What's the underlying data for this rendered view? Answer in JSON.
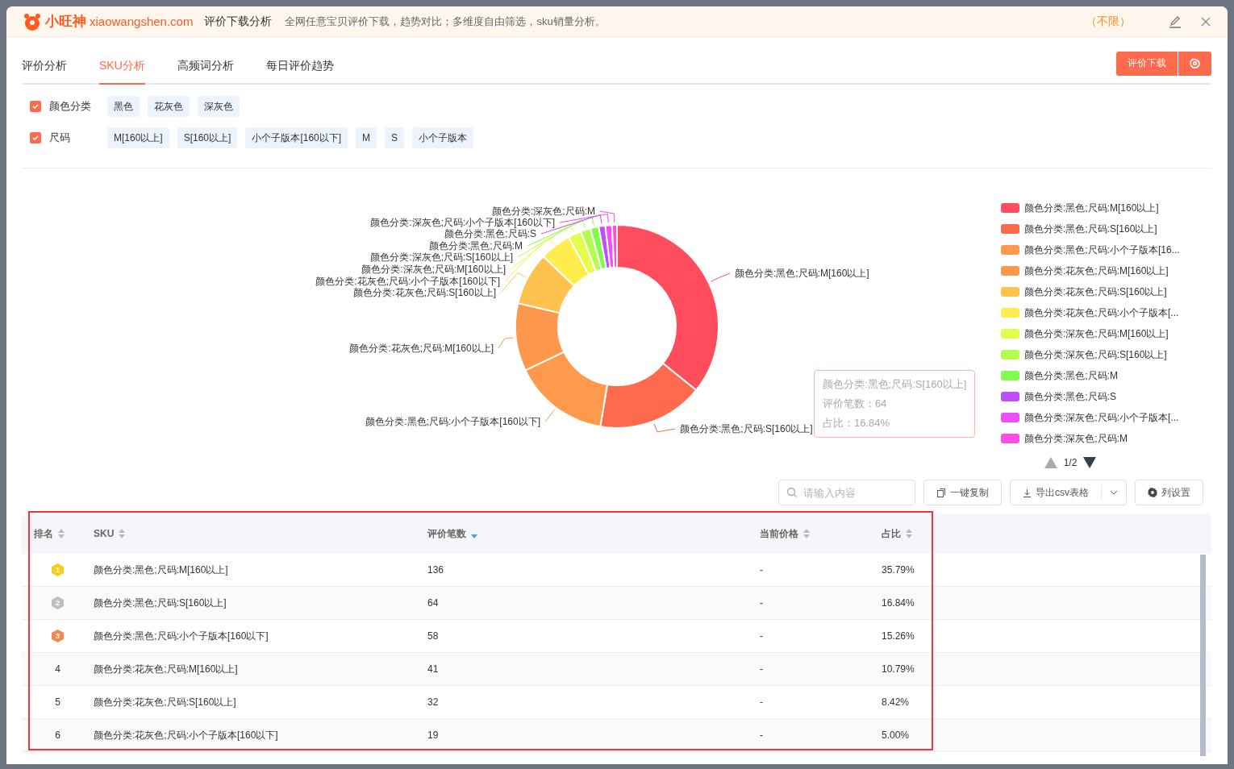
{
  "header": {
    "brand": "小旺神",
    "domain": "xiaowangshen.com",
    "title": "评价下载分析",
    "description": "全网任意宝贝评价下载，趋势对比；多维度自由筛选，sku销量分析。",
    "quota": "（不限）"
  },
  "tabs": [
    {
      "label": "评价分析",
      "selected": false
    },
    {
      "label": "SKU分析",
      "selected": true
    },
    {
      "label": "高频词分析",
      "selected": false
    },
    {
      "label": "每日评价趋势",
      "selected": false
    }
  ],
  "download_button": "评价下载",
  "filters": [
    {
      "label": "颜色分类",
      "checked": true,
      "options": [
        "黑色",
        "花灰色",
        "深灰色"
      ]
    },
    {
      "label": "尺码",
      "checked": true,
      "options": [
        "M[160以上]",
        "S[160以上]",
        "小个子版本[160以下]",
        "M",
        "S",
        "小个子版本"
      ]
    }
  ],
  "chart_data": {
    "type": "donut",
    "categories": [
      "颜色分类:黑色;尺码:M[160以上]",
      "颜色分类:黑色;尺码:S[160以上]",
      "颜色分类:黑色;尺码:小个子版本[160以下]",
      "颜色分类:花灰色;尺码:M[160以上]",
      "颜色分类:花灰色;尺码:S[160以上]",
      "颜色分类:花灰色;尺码:小个子版本[160以下]",
      "颜色分类:深灰色;尺码:M[160以上]",
      "颜色分类:深灰色;尺码:S[160以上]",
      "颜色分类:黑色;尺码:M",
      "颜色分类:黑色;尺码:S",
      "颜色分类:深灰色;尺码:小个子版本[160以下]",
      "颜色分类:深灰色;尺码:M"
    ],
    "values": [
      35.79,
      16.84,
      15.26,
      10.79,
      8.42,
      5.0,
      2.11,
      1.58,
      1.32,
      1.05,
      1.05,
      0.79
    ]
  },
  "legend": {
    "items": [
      {
        "label": "颜色分类:黑色;尺码:M[160以上]",
        "color": "#ff4d5e"
      },
      {
        "label": "颜色分类:黑色;尺码:S[160以上]",
        "color": "#ff6a4d"
      },
      {
        "label": "颜色分类:黑色;尺码:小个子版本[16...",
        "color": "#ff9a4d"
      },
      {
        "label": "颜色分类:花灰色;尺码:M[160以上]",
        "color": "#fe984c"
      },
      {
        "label": "颜色分类:花灰色;尺码:S[160以上]",
        "color": "#ffc24d"
      },
      {
        "label": "颜色分类:花灰色;尺码:小个子版本[...",
        "color": "#ffec4d"
      },
      {
        "label": "颜色分类:深灰色;尺码:M[160以上]",
        "color": "#e4fc4d"
      },
      {
        "label": "颜色分类:深灰色;尺码:S[160以上]",
        "color": "#b4fc4d"
      },
      {
        "label": "颜色分类:黑色;尺码:M",
        "color": "#80fc4d"
      },
      {
        "label": "颜色分类:黑色;尺码:S",
        "color": "#c04dfc"
      },
      {
        "label": "颜色分类:深灰色;尺码:小个子版本[...",
        "color": "#f04dfc"
      },
      {
        "label": "颜色分类:深灰色;尺码:M",
        "color": "#fc4de4"
      }
    ],
    "page": "1/2"
  },
  "tooltip": {
    "title": "颜色分类:黑色;尺码:S[160以上]",
    "lines": [
      "评价笔数：64",
      "占比：16.84%"
    ]
  },
  "toolbar": {
    "search": {
      "placeholder": "请输入内容"
    },
    "copy": "一键复制",
    "export": "导出csv表格",
    "columns": "列设置"
  },
  "table": {
    "highlighted": true,
    "columns": [
      {
        "label": "排名",
        "sorted": false
      },
      {
        "label": "SKU",
        "sorted": false
      },
      {
        "label": "评价笔数",
        "sorted": true
      },
      {
        "label": "当前价格",
        "sorted": false
      },
      {
        "label": "占比",
        "sorted": false
      }
    ],
    "rows": [
      {
        "rank": "1",
        "kind": "medal",
        "color": "#f2cf1d",
        "sku": "颜色分类:黑色;尺码:M[160以上]",
        "count": "136",
        "price": "-",
        "ratio": "35.79%"
      },
      {
        "rank": "2",
        "kind": "medal",
        "color": "#bfbfbf",
        "sku": "颜色分类:黑色;尺码:S[160以上]",
        "count": "64",
        "price": "-",
        "ratio": "16.84%"
      },
      {
        "rank": "3",
        "kind": "medal",
        "color": "#f08a52",
        "sku": "颜色分类:黑色;尺码:小个子版本[160以下]",
        "count": "58",
        "price": "-",
        "ratio": "15.26%"
      },
      {
        "rank": "4",
        "kind": "number",
        "sku": "颜色分类:花灰色;尺码:M[160以上]",
        "count": "41",
        "price": "-",
        "ratio": "10.79%"
      },
      {
        "rank": "5",
        "kind": "number",
        "sku": "颜色分类:花灰色;尺码:S[160以上]",
        "count": "32",
        "price": "-",
        "ratio": "8.42%"
      },
      {
        "rank": "6",
        "kind": "number",
        "sku": "颜色分类:花灰色;尺码:小个子版本[160以下]",
        "count": "19",
        "price": "-",
        "ratio": "5.00%"
      }
    ]
  }
}
